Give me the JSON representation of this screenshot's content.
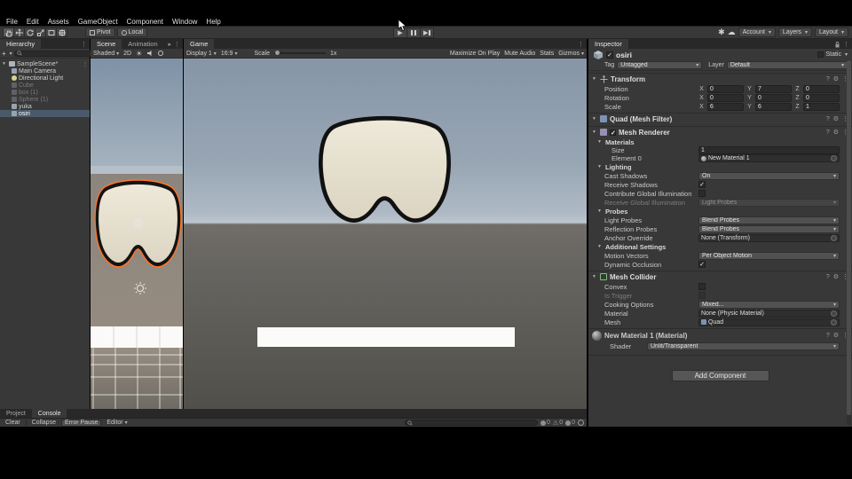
{
  "menu_bar": {
    "items": [
      "File",
      "Edit",
      "Assets",
      "GameObject",
      "Component",
      "Window",
      "Help"
    ]
  },
  "toolbar": {
    "pivot": "Pivot",
    "local": "Local",
    "account": "Account",
    "layers": "Layers",
    "layout": "Layout"
  },
  "hierarchy": {
    "tab": "Hierarchy",
    "scene_name": "SampleScene*",
    "items": [
      {
        "label": "Main Camera"
      },
      {
        "label": "Directional Light"
      },
      {
        "label": "Cube"
      },
      {
        "label": "box (1)"
      },
      {
        "label": "Sphere (1)"
      },
      {
        "label": "yuka"
      },
      {
        "label": "osiri"
      }
    ]
  },
  "scene_view": {
    "tab_scene": "Scene",
    "tab_animation": "Animation",
    "shading": "Shaded",
    "btn_2d": "2D"
  },
  "game_view": {
    "tab": "Game",
    "display": "Display 1",
    "aspect": "16:9",
    "scale_label": "Scale",
    "scale_value": "1x",
    "maximize": "Maximize On Play",
    "mute": "Mute Audio",
    "stats": "Stats",
    "gizmos": "Gizmos"
  },
  "inspector": {
    "tab": "Inspector",
    "header": {
      "name": "osiri",
      "static": "Static"
    },
    "tag_label": "Tag",
    "tag_value": "Untagged",
    "layer_label": "Layer",
    "layer_value": "Default",
    "transform": {
      "title": "Transform",
      "axis_x": "X",
      "axis_y": "Y",
      "axis_z": "Z",
      "position": {
        "label": "Position",
        "x": "0",
        "y": "7",
        "z": "0"
      },
      "rotation": {
        "label": "Rotation",
        "x": "0",
        "y": "0",
        "z": "0"
      },
      "scale": {
        "label": "Scale",
        "x": "6",
        "y": "6",
        "z": "1"
      }
    },
    "mesh_filter": {
      "title": "Quad (Mesh Filter)"
    },
    "mesh_renderer": {
      "title": "Mesh Renderer",
      "materials": {
        "title": "Materials",
        "size_label": "Size",
        "size_value": "1",
        "element_label": "Element 0",
        "element_value": "New Material 1"
      },
      "lighting": {
        "title": "Lighting",
        "cast_shadows_label": "Cast Shadows",
        "cast_shadows_value": "On",
        "receive_shadows_label": "Receive Shadows",
        "contribute_gi_label": "Contribute Global Illumination",
        "receive_gi_label": "Receive Global Illumination",
        "receive_gi_value": "Light Probes"
      },
      "probes": {
        "title": "Probes",
        "light_probes_label": "Light Probes",
        "light_probes_value": "Blend Probes",
        "reflection_probes_label": "Reflection Probes",
        "reflection_probes_value": "Blend Probes",
        "anchor_label": "Anchor Override",
        "anchor_value": "None (Transform)"
      },
      "additional": {
        "title": "Additional Settings",
        "motion_vectors_label": "Motion Vectors",
        "motion_vectors_value": "Per Object Motion",
        "dynamic_occlusion_label": "Dynamic Occlusion"
      }
    },
    "mesh_collider": {
      "title": "Mesh Collider",
      "convex_label": "Convex",
      "is_trigger_label": "Is Trigger",
      "cooking_label": "Cooking Options",
      "cooking_value": "Mixed...",
      "material_label": "Material",
      "material_value": "None (Physic Material)",
      "mesh_label": "Mesh",
      "mesh_value": "Quad"
    },
    "material": {
      "title": "New Material 1 (Material)",
      "shader_label": "Shader",
      "shader_value": "Unlit/Transparent"
    },
    "add_component": "Add Component"
  },
  "console": {
    "tab_project": "Project",
    "tab_console": "Console",
    "clear": "Clear",
    "collapse": "Collapse",
    "error_pause": "Error Pause",
    "editor": "Editor",
    "info_count": "0",
    "warning_count": "0",
    "error_count": "0"
  },
  "colors": {
    "selection_outline": "#ff7428",
    "blob_fill": "#e9e3d3",
    "hierarchy_selection": "#4a5a6a"
  }
}
